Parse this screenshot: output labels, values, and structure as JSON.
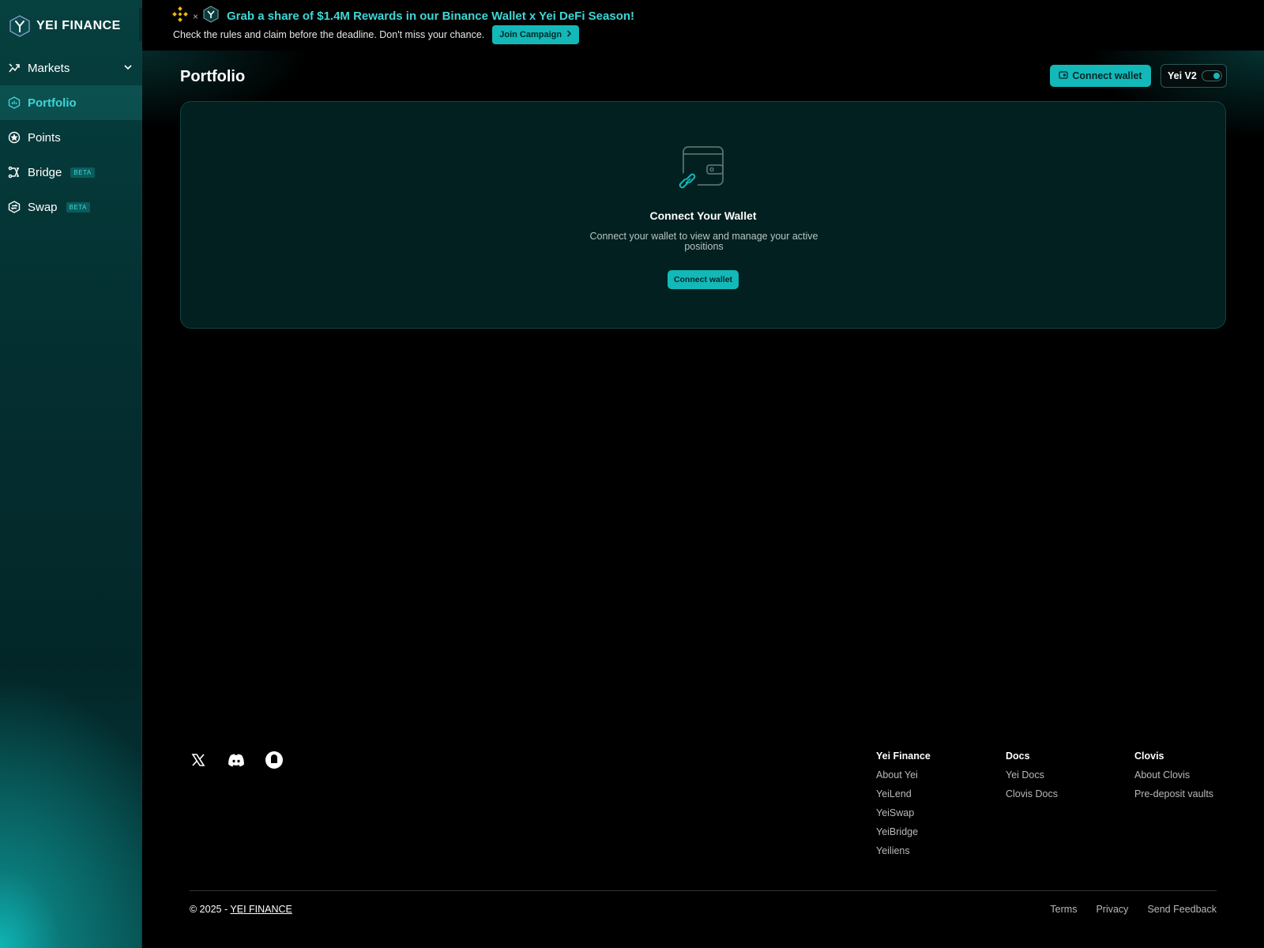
{
  "brand": {
    "name": "YEI FINANCE"
  },
  "sidebar": {
    "items": [
      {
        "label": "Markets",
        "icon": "markets-icon"
      },
      {
        "label": "Portfolio",
        "icon": "portfolio-icon",
        "active": true
      },
      {
        "label": "Points",
        "icon": "points-icon"
      },
      {
        "label": "Bridge",
        "icon": "bridge-icon",
        "badge": "BETA"
      },
      {
        "label": "Swap",
        "icon": "swap-icon",
        "badge": "BETA"
      }
    ]
  },
  "banner": {
    "separator": "×",
    "title": "Grab a share of $1.4M Rewards in our Binance Wallet x Yei DeFi Season!",
    "subtitle": "Check the rules and claim before the deadline. Don't miss your chance.",
    "cta": "Join Campaign"
  },
  "header": {
    "title": "Portfolio",
    "connect_label": "Connect wallet",
    "version_label": "Yei V2"
  },
  "empty_state": {
    "title": "Connect Your Wallet",
    "description": "Connect your wallet to view and manage your active positions",
    "button": "Connect wallet"
  },
  "footer": {
    "socials": [
      "x-icon",
      "discord-icon",
      "chat-icon"
    ],
    "columns": [
      {
        "heading": "Yei Finance",
        "links": [
          "About Yei",
          "YeiLend",
          "YeiSwap",
          "YeiBridge",
          "Yeiliens"
        ]
      },
      {
        "heading": "Docs",
        "links": [
          "Yei Docs",
          "Clovis Docs"
        ]
      },
      {
        "heading": "Clovis",
        "links": [
          "About Clovis",
          "Pre-deposit vaults"
        ]
      }
    ],
    "copyright_prefix": "© 2025 -",
    "copyright_link": "YEI FINANCE",
    "bottom_links": [
      "Terms",
      "Privacy",
      "Send Feedback"
    ]
  },
  "colors": {
    "accent": "#13b8b8",
    "accent_text": "#3fd6d6",
    "sidebar_bg": "#042e30",
    "card_bg": "#01201f"
  }
}
